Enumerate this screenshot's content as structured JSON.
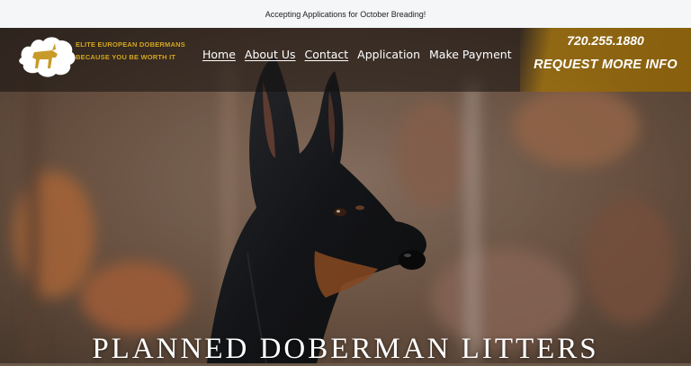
{
  "announcement": "Accepting Applications for October Breading!",
  "logo": {
    "line1": "ELITE EUROPEAN DOBERMANS",
    "line2": "BECAUSE YOU BE WORTH IT"
  },
  "nav": {
    "items": [
      {
        "label": "Home",
        "underlined": true
      },
      {
        "label": "About Us",
        "underlined": true
      },
      {
        "label": "Contact",
        "underlined": true
      },
      {
        "label": "Application",
        "underlined": false
      },
      {
        "label": "Make Payment",
        "underlined": false
      }
    ]
  },
  "contact": {
    "phone": "720.255.1880",
    "cta": "REQUEST MORE INFO"
  },
  "hero": {
    "headline": "PLANNED DOBERMAN LITTERS",
    "image": "doberman-portrait-photo"
  },
  "colors": {
    "gold": "#d4a62a",
    "cta_panel": "#a97a10",
    "announcement_bg": "#f4f6f7"
  }
}
